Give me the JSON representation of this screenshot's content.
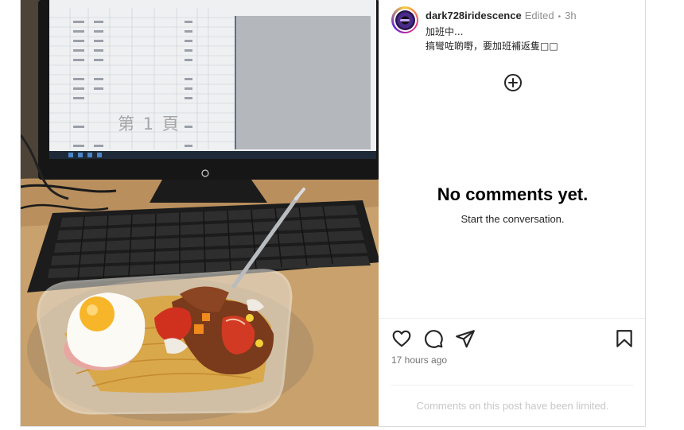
{
  "post": {
    "author": {
      "username": "dark728iridescence",
      "edited_label": "Edited",
      "separator": "•",
      "time": "3h"
    },
    "caption_lines": [
      "加班中...",
      "搞彎咗啲嘢，要加班補返隻□□"
    ],
    "photo": {
      "sheet_page_label": "第 1 頁",
      "description_icon": "photo"
    },
    "comments": {
      "empty_title": "No comments yet.",
      "empty_subtitle": "Start the conversation."
    },
    "actions": [
      {
        "name": "like",
        "icon": "heart-icon"
      },
      {
        "name": "comment",
        "icon": "comment-icon"
      },
      {
        "name": "share",
        "icon": "send-icon"
      },
      {
        "name": "save",
        "icon": "bookmark-icon"
      }
    ],
    "timestamp": "17 hours ago",
    "limited_notice": "Comments on this post have been limited."
  },
  "colors": {
    "text": "#262626",
    "muted": "#8e8e8e",
    "border": "#dbdbdb",
    "limited_text": "#c7c7c7"
  }
}
